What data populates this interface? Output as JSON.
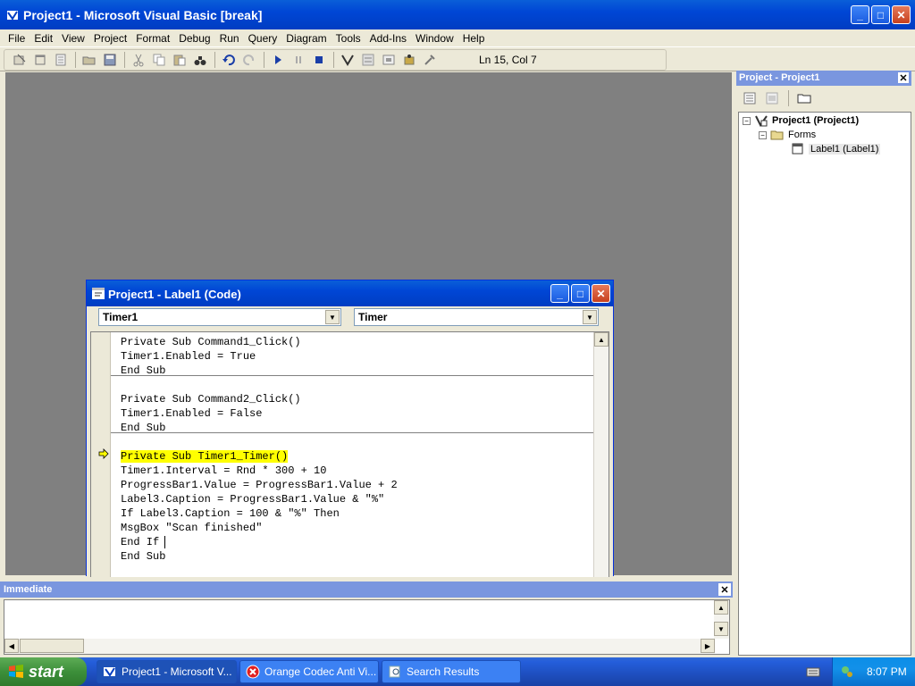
{
  "main_window": {
    "title": "Project1 - Microsoft Visual Basic [break]",
    "controls": {
      "minimize": "_",
      "maximize": "□",
      "close": "✕"
    }
  },
  "menu": [
    "File",
    "Edit",
    "View",
    "Project",
    "Format",
    "Debug",
    "Run",
    "Query",
    "Diagram",
    "Tools",
    "Add-Ins",
    "Window",
    "Help"
  ],
  "toolbar": {
    "icons": [
      "add-project-icon",
      "add-form-icon",
      "menu-editor-icon",
      "open-project-icon",
      "save-project-icon",
      "cut-icon",
      "copy-icon",
      "paste-icon",
      "find-icon",
      "undo-icon",
      "redo-icon",
      "start-icon",
      "break-icon",
      "end-icon",
      "project-explorer-icon",
      "properties-icon",
      "form-layout-icon",
      "object-browser-icon",
      "toolbox-icon"
    ],
    "position_status": "Ln 15, Col 7"
  },
  "code_window": {
    "title": "Project1 - Label1 (Code)",
    "object_combo": "Timer1",
    "procedure_combo": "Timer",
    "lines": [
      "Private Sub Command1_Click()",
      "Timer1.Enabled = True",
      "End Sub",
      "",
      "Private Sub Command2_Click()",
      "Timer1.Enabled = False",
      "End Sub",
      "",
      "Private Sub Timer1_Timer()",
      "Timer1.Interval = Rnd * 300 + 10",
      "ProgressBar1.Value = ProgressBar1.Value + 2",
      "Label3.Caption = ProgressBar1.Value & \"%\"",
      "If Label3.Caption = 100 & \"%\" Then",
      "MsgBox \"Scan finished\"",
      "End If",
      "End Sub"
    ],
    "highlighted_line": 8
  },
  "project_explorer": {
    "title": "Project - Project1",
    "close": "✕",
    "root": "Project1 (Project1)",
    "folder": "Forms",
    "item": "Label1 (Label1)",
    "expander_root": "−",
    "expander_folder": "−"
  },
  "immediate": {
    "title": "Immediate",
    "close": "✕"
  },
  "taskbar": {
    "start_label": "start",
    "tasks": [
      {
        "label": "Project1 - Microsoft V..."
      },
      {
        "label": "Orange Codec Anti Vi..."
      },
      {
        "label": "Search Results"
      }
    ],
    "clock": "8:07 PM"
  },
  "colors": {
    "titlebar_blue": "#0046d5",
    "highlight_yellow": "#ffff00",
    "mdi_gray": "#808080"
  }
}
